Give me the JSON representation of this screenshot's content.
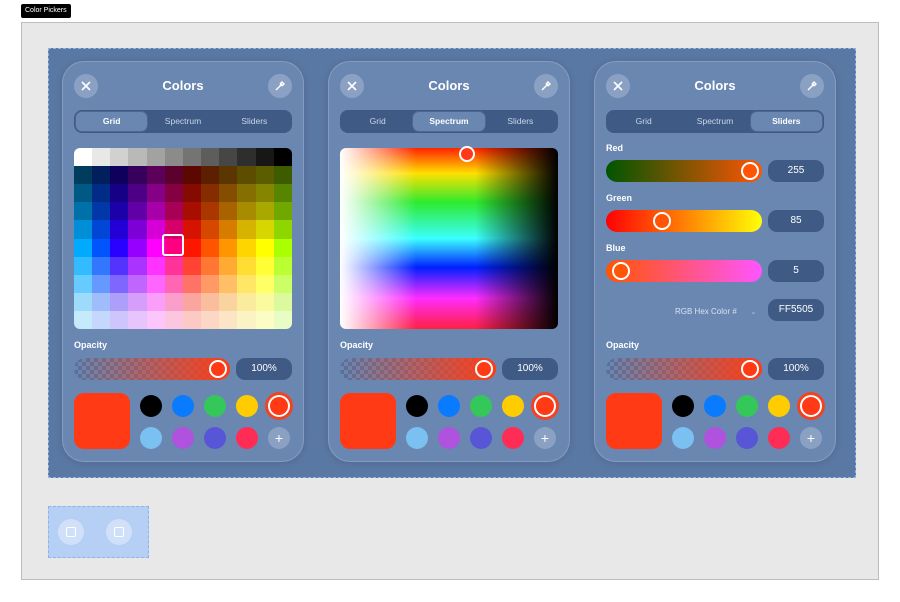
{
  "frame_label": "Color Pickers",
  "panels": [
    {
      "title": "Colors",
      "tabs": [
        "Grid",
        "Spectrum",
        "Sliders"
      ],
      "active_tab": "Grid",
      "opacity_label": "Opacity",
      "opacity_value": "100%",
      "opacity_fraction": 1.0
    },
    {
      "title": "Colors",
      "tabs": [
        "Grid",
        "Spectrum",
        "Sliders"
      ],
      "active_tab": "Spectrum",
      "opacity_label": "Opacity",
      "opacity_value": "100%",
      "opacity_fraction": 1.0
    },
    {
      "title": "Colors",
      "tabs": [
        "Grid",
        "Spectrum",
        "Sliders"
      ],
      "active_tab": "Sliders",
      "opacity_label": "Opacity",
      "opacity_value": "100%",
      "opacity_fraction": 1.0,
      "sliders": [
        {
          "label": "Red",
          "value": "255"
        },
        {
          "label": "Green",
          "value": "85"
        },
        {
          "label": "Blue",
          "value": "5"
        }
      ],
      "hex_label": "RGB Hex Color #",
      "hex_value": "FF5505"
    }
  ],
  "current_color": "#ff3a14",
  "swatches_row1": [
    "#000000",
    "#0a7aff",
    "#34c759",
    "#ffcc00",
    "#ff3a14"
  ],
  "swatches_row2": [
    "#7ac0f0",
    "#af52de",
    "#5856d6",
    "#ff2d55"
  ],
  "add_swatch_label": "+",
  "icons": {
    "close": "close-icon",
    "eyedropper": "eyedropper-icon",
    "chevron": "chevron-down-icon"
  }
}
